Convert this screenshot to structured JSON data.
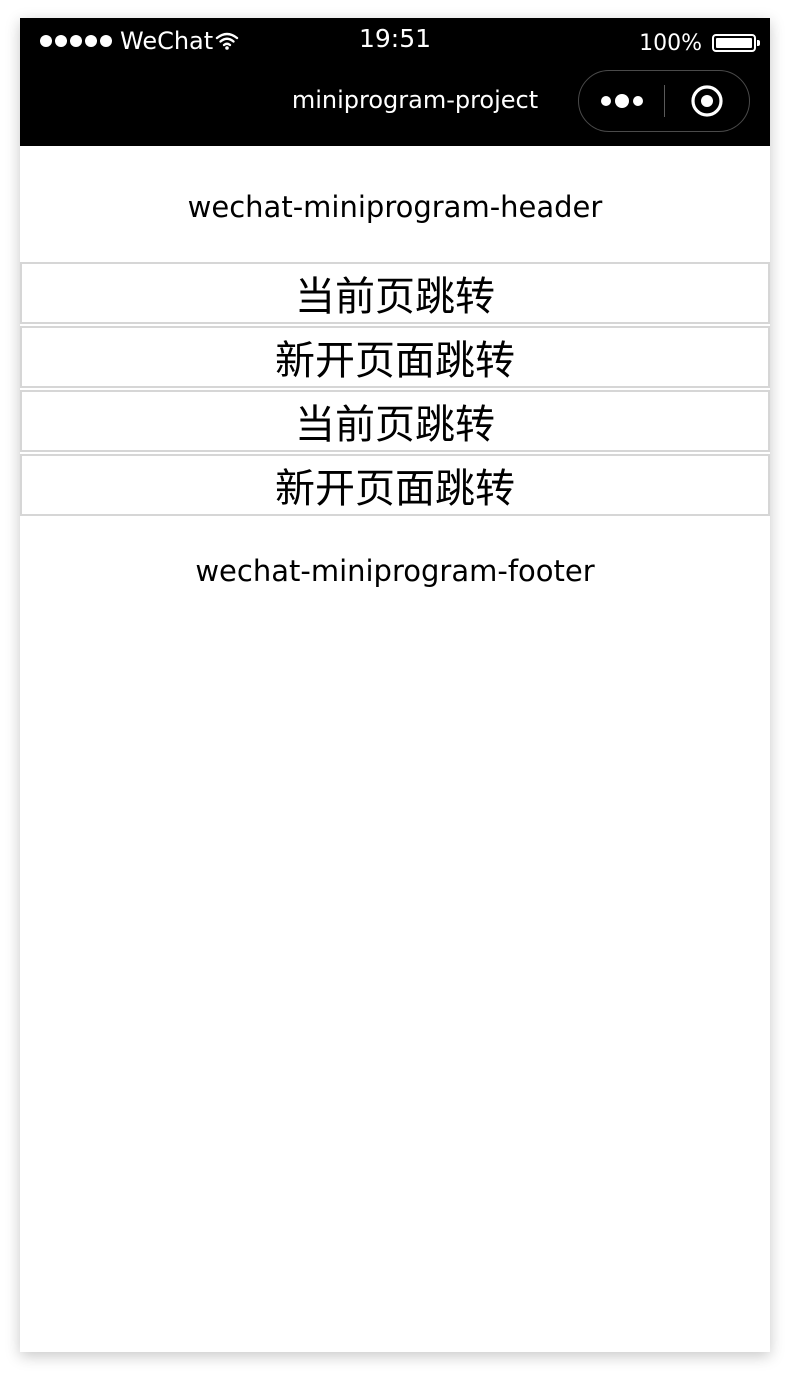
{
  "status_bar": {
    "carrier": "WeChat",
    "time": "19:51",
    "battery_percent": "100%",
    "battery_level": 1.0,
    "signal_icon": "signal-dots-icon",
    "wifi_icon": "wifi-icon",
    "battery_icon": "battery-icon"
  },
  "nav_bar": {
    "title": "miniprogram-project",
    "more_icon": "more-dots-icon",
    "close_icon": "target-close-icon",
    "background": "#000000",
    "text_color": "#ffffff"
  },
  "page": {
    "header": "wechat-miniprogram-header",
    "footer": "wechat-miniprogram-footer",
    "nav_items": [
      {
        "label": "当前页跳转"
      },
      {
        "label": "新开页面跳转"
      },
      {
        "label": "当前页跳转"
      },
      {
        "label": "新开页面跳转"
      }
    ],
    "item_border_color": "#d6d6d6"
  }
}
